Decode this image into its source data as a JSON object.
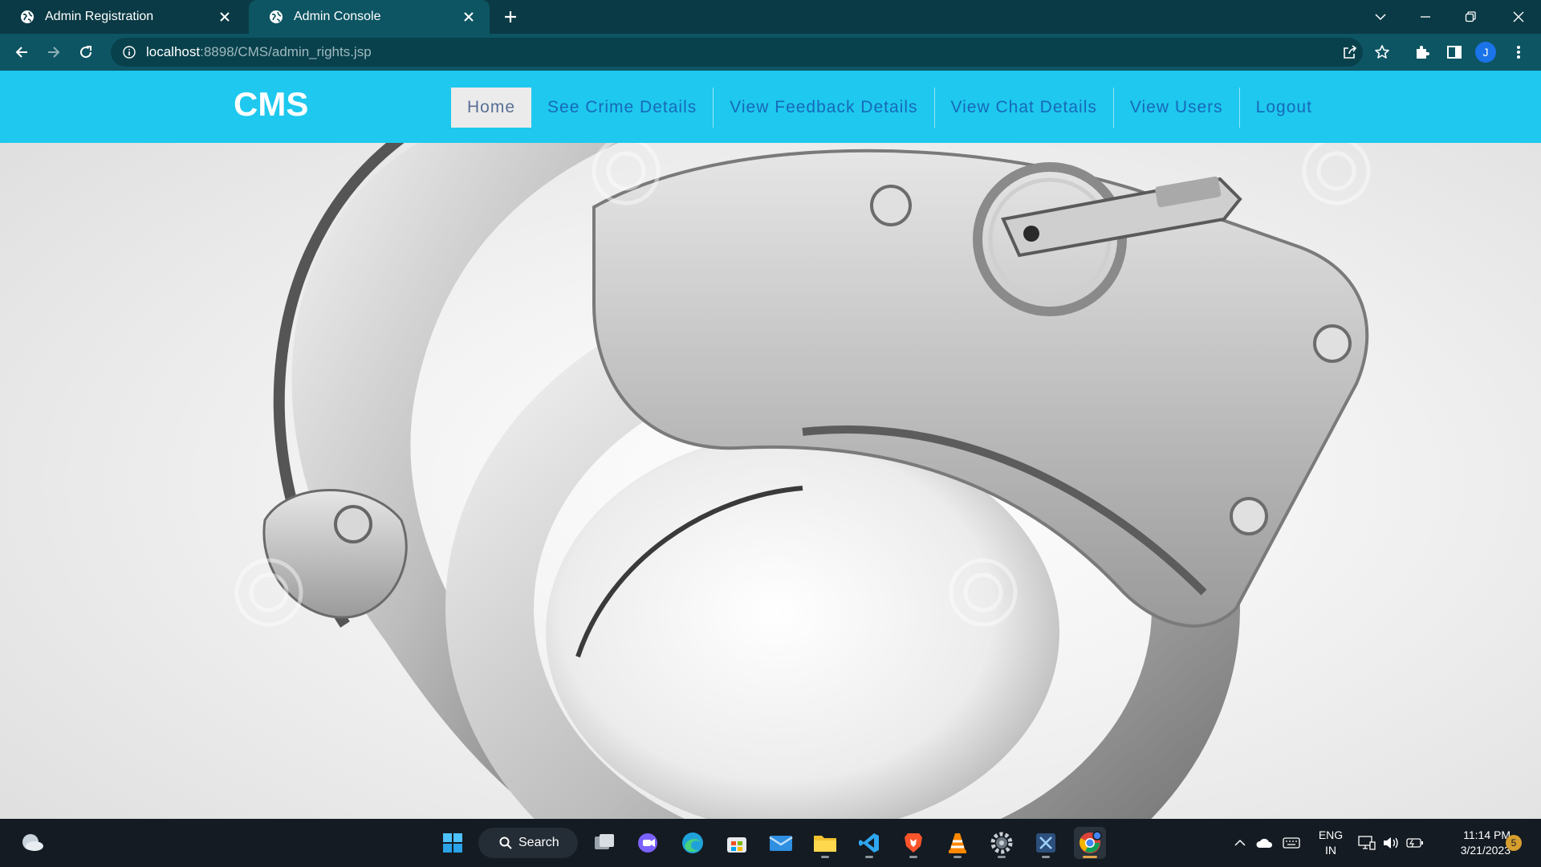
{
  "browser": {
    "tabs": [
      {
        "title": "Admin Registration",
        "active": false
      },
      {
        "title": "Admin Console",
        "active": true
      }
    ],
    "url_host": "localhost",
    "url_rest": ":8898/CMS/admin_rights.jsp",
    "profile_initial": "J",
    "icons": [
      "globe-icon",
      "close-icon",
      "plus-icon",
      "back-icon",
      "forward-icon",
      "reload-icon",
      "info-icon",
      "share-icon",
      "star-icon",
      "puzzle-icon",
      "sidepanel-icon",
      "menu-icon"
    ]
  },
  "site": {
    "brand": "CMS",
    "nav": [
      {
        "label": "Home",
        "active": true
      },
      {
        "label": "See Crime Details",
        "active": false
      },
      {
        "label": "View Feedback Details",
        "active": false
      },
      {
        "label": "View Chat Details",
        "active": false
      },
      {
        "label": "View Users",
        "active": false
      },
      {
        "label": "Logout",
        "active": false
      }
    ],
    "colors": {
      "navbar": "#1ec8ee",
      "nav_link": "#1769b9",
      "active_bg": "#ebebeb"
    },
    "hero_image": "handcuffs-photo"
  },
  "taskbar": {
    "search_label": "Search",
    "language": "ENG",
    "region": "IN",
    "time": "11:14 PM",
    "date": "3/21/2023",
    "notification_count": "5",
    "apps": [
      "start-icon",
      "task-view-icon",
      "meet-icon",
      "edge-icon",
      "store-icon",
      "mail-icon",
      "file-explorer-icon",
      "vscode-icon",
      "brave-icon",
      "vlc-icon",
      "settings-icon",
      "snipping-icon",
      "chrome-icon"
    ]
  }
}
